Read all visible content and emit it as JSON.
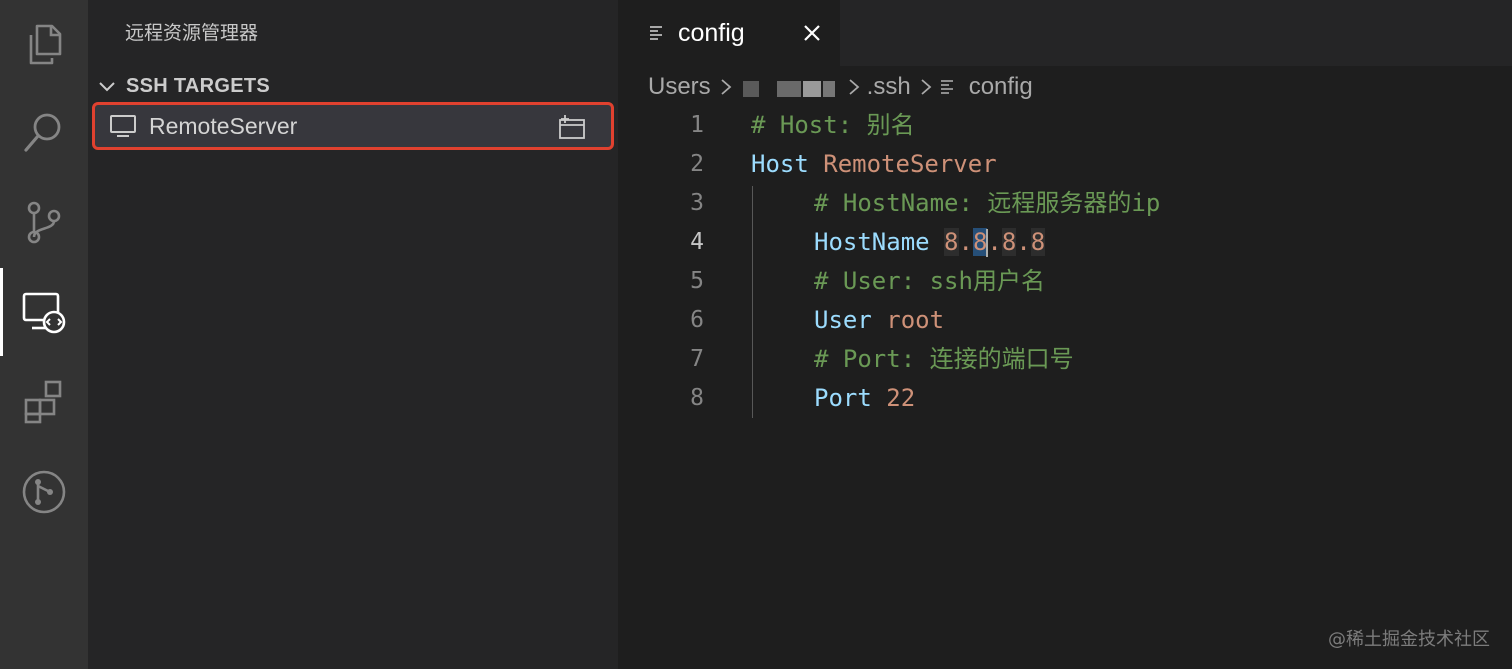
{
  "activity_bar": {
    "items": [
      {
        "icon": "files-icon"
      },
      {
        "icon": "search-icon"
      },
      {
        "icon": "source-control-icon"
      },
      {
        "icon": "remote-explorer-icon",
        "active": true
      },
      {
        "icon": "extensions-icon"
      },
      {
        "icon": "git-graph-icon"
      }
    ]
  },
  "sidebar": {
    "title": "远程资源管理器",
    "section": "SSH TARGETS",
    "targets": [
      {
        "name": "RemoteServer",
        "icon": "monitor-icon",
        "action_icon": "new-window-icon"
      }
    ],
    "highlight_color": "#e0412f"
  },
  "editor": {
    "tab": {
      "name": "config",
      "icon": "file-lines-icon",
      "close_icon": "close-icon"
    },
    "breadcrumbs": [
      "Users",
      ".ssh",
      "config"
    ],
    "lines": [
      {
        "n": "1",
        "text": "# Host: 别名"
      },
      {
        "n": "2",
        "kw": "Host",
        "val": "RemoteServer"
      },
      {
        "n": "3",
        "text": "# HostName: 远程服务器的ip"
      },
      {
        "n": "4",
        "kw": "HostName",
        "val": "8.8.8.8"
      },
      {
        "n": "5",
        "text": "# User: ssh用户名"
      },
      {
        "n": "6",
        "kw": "User",
        "val": "root"
      },
      {
        "n": "7",
        "text": "# Port: 连接的端口号"
      },
      {
        "n": "8",
        "kw": "Port",
        "val": "22"
      }
    ],
    "current_line": 4,
    "colors": {
      "comment": "#6a9955",
      "keyword": "#9cdcfe",
      "value": "#ce9178"
    }
  },
  "watermark": "@稀土掘金技术社区"
}
